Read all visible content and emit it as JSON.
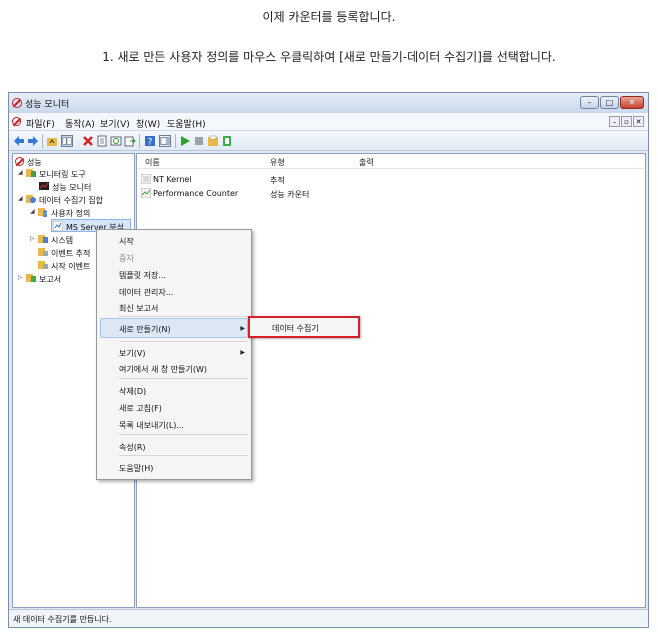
{
  "instructions": {
    "line1": "이제 카운터를 등록합니다.",
    "line2": "1. 새로 만든 사용자 정의를 마우스 우클릭하여 [새로 만들기-데이터 수집기]를 선택합니다."
  },
  "window": {
    "title": "성능 모니터",
    "controls": {
      "minimize": "–",
      "maximize": "□",
      "close": "✕"
    }
  },
  "menubar": {
    "items": [
      "파일(F)",
      "동작(A)",
      "보기(V)",
      "창(W)",
      "도움말(H)"
    ],
    "mdi_controls": [
      "–",
      "▫",
      "✕"
    ]
  },
  "tree": {
    "root": "성능",
    "monitoring_tools": "모니터링 도구",
    "perf_monitor": "성능 모니터",
    "data_collector_sets": "데이터 수집기 집합",
    "user_defined": "사용자 정의",
    "ms_server": "MS Server 분석",
    "system": "시스템",
    "event_trace": "이벤트 추적",
    "startup_event": "시작 이벤트",
    "reports": "보고서"
  },
  "list": {
    "columns": [
      "이름",
      "유형",
      "출력"
    ],
    "rows": [
      {
        "name": "NT Kernel",
        "type": "추적",
        "output": ""
      },
      {
        "name": "Performance Counter",
        "type": "성능 카운터",
        "output": ""
      }
    ]
  },
  "context_menu": {
    "start": "시작",
    "stop": "중지",
    "save_template": "템플릿 저장...",
    "data_manager": "데이터 관리자...",
    "latest_report": "최신 보고서",
    "new": "새로 만들기(N)",
    "view": "보기(V)",
    "new_window": "여기에서 새 창 만들기(W)",
    "delete": "삭제(D)",
    "refresh": "새로 고침(F)",
    "export": "목록 내보내기(L)...",
    "properties": "속성(R)",
    "help": "도움말(H)"
  },
  "submenu": {
    "data_collector": "데이터 수집기"
  },
  "status": {
    "text": "새 데이터 수집기를 만듭니다."
  },
  "colors": {
    "highlight_border": "#d61f26",
    "accent": "#3a6ea5"
  }
}
